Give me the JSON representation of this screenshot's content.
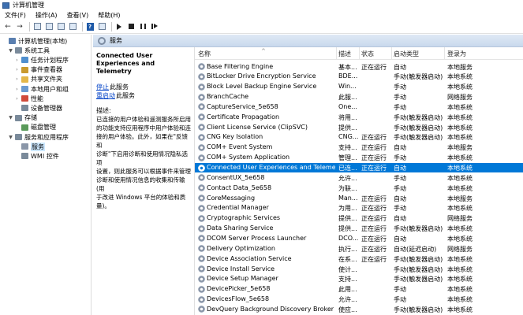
{
  "window": {
    "title": "计算机管理"
  },
  "menu": [
    {
      "label": "文件(F)"
    },
    {
      "label": "操作(A)"
    },
    {
      "label": "查看(V)"
    },
    {
      "label": "帮助(H)"
    }
  ],
  "tree": {
    "items": [
      {
        "label": "计算机管理(本地)",
        "level": 0,
        "expander": "",
        "icon": "computer-icon",
        "color": "#5a7fb0"
      },
      {
        "label": "系统工具",
        "level": 1,
        "expander": "▼",
        "icon": "tools-icon",
        "color": "#7a8a9a"
      },
      {
        "label": "任务计划程序",
        "level": 2,
        "expander": "›",
        "icon": "clock-icon",
        "color": "#4f8fcf"
      },
      {
        "label": "事件查看器",
        "level": 2,
        "expander": "›",
        "icon": "event-icon",
        "color": "#c99a2e"
      },
      {
        "label": "共享文件夹",
        "level": 2,
        "expander": "›",
        "icon": "folder-icon",
        "color": "#e3b74a"
      },
      {
        "label": "本地用户和组",
        "level": 2,
        "expander": "›",
        "icon": "users-icon",
        "color": "#6a9ad0"
      },
      {
        "label": "性能",
        "level": 2,
        "expander": "›",
        "icon": "perf-icon",
        "color": "#d04a3a"
      },
      {
        "label": "设备管理器",
        "level": 2,
        "expander": "",
        "icon": "device-icon",
        "color": "#7a8a9a"
      },
      {
        "label": "存储",
        "level": 1,
        "expander": "▼",
        "icon": "storage-icon",
        "color": "#7a8a9a"
      },
      {
        "label": "磁盘管理",
        "level": 2,
        "expander": "",
        "icon": "disk-icon",
        "color": "#5a9a5a"
      },
      {
        "label": "服务和应用程序",
        "level": 1,
        "expander": "▼",
        "icon": "apps-icon",
        "color": "#7a8a9a"
      },
      {
        "label": "服务",
        "level": 2,
        "expander": "",
        "icon": "gear-icon",
        "color": "#8a96a8",
        "selected": true
      },
      {
        "label": "WMI 控件",
        "level": 2,
        "expander": "",
        "icon": "wmi-icon",
        "color": "#7a8a9a"
      }
    ]
  },
  "services_header": {
    "title": "服务"
  },
  "description_pane": {
    "service_title": "Connected User Experiences and Telemetry",
    "stop_link": "停止",
    "stop_suffix": "此服务",
    "restart_link": "重启动",
    "restart_suffix": "此服务",
    "desc_label": "描述:",
    "desc_text": "已连接的用户体验和遥测服务所启用\n的功能支持应用程序中用户体验和连\n接的用户体验。此外，如果在\"反馈和\n诊断\"下启用诊断和使用情况隐私选项\n设置，则此服务可以根据事件来管理\n诊断和使用情况信息的收集和传输(用\n于改进 Windows 平台的体验和质\n量)。"
  },
  "columns": {
    "name": "名称",
    "desc": "描述",
    "state": "状态",
    "type": "启动类型",
    "logon": "登录为"
  },
  "services": [
    {
      "name": "Base Filtering Engine",
      "desc": "基本...",
      "state": "正在运行",
      "type": "自动",
      "logon": "本地服务"
    },
    {
      "name": "BitLocker Drive Encryption Service",
      "desc": "BDE...",
      "state": "",
      "type": "手动(触发器启动)",
      "logon": "本地系统"
    },
    {
      "name": "Block Level Backup Engine Service",
      "desc": "Win...",
      "state": "",
      "type": "手动",
      "logon": "本地系统"
    },
    {
      "name": "BranchCache",
      "desc": "此服...",
      "state": "",
      "type": "手动",
      "logon": "网络服务"
    },
    {
      "name": "CaptureService_5e658",
      "desc": "One...",
      "state": "",
      "type": "手动",
      "logon": "本地系统"
    },
    {
      "name": "Certificate Propagation",
      "desc": "将用...",
      "state": "",
      "type": "手动(触发器启动)",
      "logon": "本地系统"
    },
    {
      "name": "Client License Service (ClipSVC)",
      "desc": "提供...",
      "state": "",
      "type": "手动(触发器启动)",
      "logon": "本地系统"
    },
    {
      "name": "CNG Key Isolation",
      "desc": "CNG...",
      "state": "正在运行",
      "type": "手动(触发器启动)",
      "logon": "本地系统"
    },
    {
      "name": "COM+ Event System",
      "desc": "支持...",
      "state": "正在运行",
      "type": "自动",
      "logon": "本地服务"
    },
    {
      "name": "COM+ System Application",
      "desc": "管理...",
      "state": "正在运行",
      "type": "手动",
      "logon": "本地系统"
    },
    {
      "name": "Connected User Experiences and Telemetry",
      "desc": "已连...",
      "state": "正在运行",
      "type": "自动",
      "logon": "本地系统",
      "selected": true
    },
    {
      "name": "ConsentUX_5e658",
      "desc": "允许...",
      "state": "",
      "type": "手动",
      "logon": "本地系统"
    },
    {
      "name": "Contact Data_5e658",
      "desc": "为联...",
      "state": "",
      "type": "手动",
      "logon": "本地系统"
    },
    {
      "name": "CoreMessaging",
      "desc": "Man...",
      "state": "正在运行",
      "type": "自动",
      "logon": "本地服务"
    },
    {
      "name": "Credential Manager",
      "desc": "为用...",
      "state": "正在运行",
      "type": "手动",
      "logon": "本地系统"
    },
    {
      "name": "Cryptographic Services",
      "desc": "提供...",
      "state": "正在运行",
      "type": "自动",
      "logon": "网络服务"
    },
    {
      "name": "Data Sharing Service",
      "desc": "提供...",
      "state": "正在运行",
      "type": "手动(触发器启动)",
      "logon": "本地系统"
    },
    {
      "name": "DCOM Server Process Launcher",
      "desc": "DCO...",
      "state": "正在运行",
      "type": "自动",
      "logon": "本地系统"
    },
    {
      "name": "Delivery Optimization",
      "desc": "执行...",
      "state": "正在运行",
      "type": "自动(延迟启动)",
      "logon": "网络服务"
    },
    {
      "name": "Device Association Service",
      "desc": "在系...",
      "state": "正在运行",
      "type": "手动(触发器启动)",
      "logon": "本地系统"
    },
    {
      "name": "Device Install Service",
      "desc": "使计...",
      "state": "",
      "type": "手动(触发器启动)",
      "logon": "本地系统"
    },
    {
      "name": "Device Setup Manager",
      "desc": "支持...",
      "state": "",
      "type": "手动(触发器启动)",
      "logon": "本地系统"
    },
    {
      "name": "DevicePicker_5e658",
      "desc": "此用...",
      "state": "",
      "type": "手动",
      "logon": "本地系统"
    },
    {
      "name": "DevicesFlow_5e658",
      "desc": "允许...",
      "state": "",
      "type": "手动",
      "logon": "本地系统"
    },
    {
      "name": "DevQuery Background Discovery Broker",
      "desc": "使应...",
      "state": "",
      "type": "手动(触发器启动)",
      "logon": "本地系统"
    }
  ]
}
